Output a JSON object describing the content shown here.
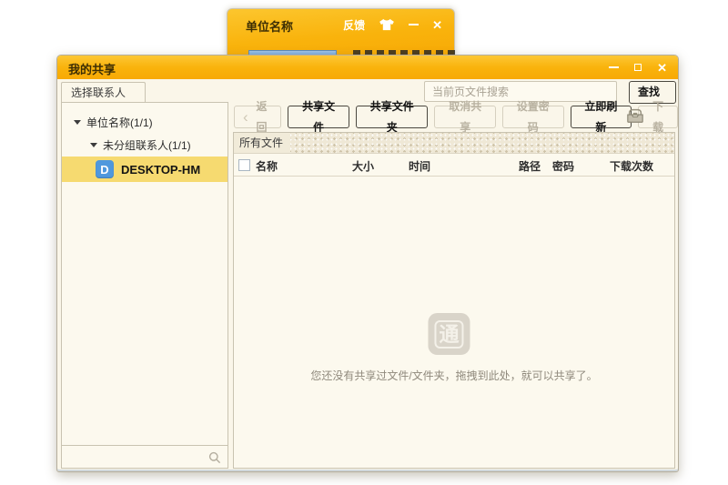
{
  "background_window": {
    "title": "单位名称",
    "feedback_label": "反馈",
    "close_glyph": "✕"
  },
  "main_window": {
    "title": "我的共享",
    "close_glyph": "✕"
  },
  "sidebar": {
    "tab_label": "选择联系人",
    "tree": {
      "root": "单位名称(1/1)",
      "group": "未分组联系人(1/1)",
      "contact": "DESKTOP-HM",
      "contact_icon_letter": "D"
    }
  },
  "search": {
    "placeholder": "当前页文件搜索",
    "find_label": "查找"
  },
  "toolbar": {
    "back": "返回",
    "share_file": "共享文件",
    "share_folder": "共享文件夹",
    "cancel_share": "取消共享",
    "set_password": "设置密码",
    "refresh": "立即刷新",
    "download": "下载"
  },
  "files": {
    "section_label": "所有文件",
    "columns": [
      "名称",
      "大小",
      "时间",
      "路径",
      "密码",
      "下载次数"
    ],
    "empty": {
      "icon_char": "通",
      "message": "您还没有共享过文件/文件夹，拖拽到此处，就可以共享了。"
    }
  },
  "colors": {
    "titlebar_orange": "#F9B30C",
    "selection_yellow": "#F6DA70",
    "contact_icon_blue": "#4F98DD",
    "progress_blue": "#6EA3D8",
    "window_bg": "#FAF6E9"
  }
}
